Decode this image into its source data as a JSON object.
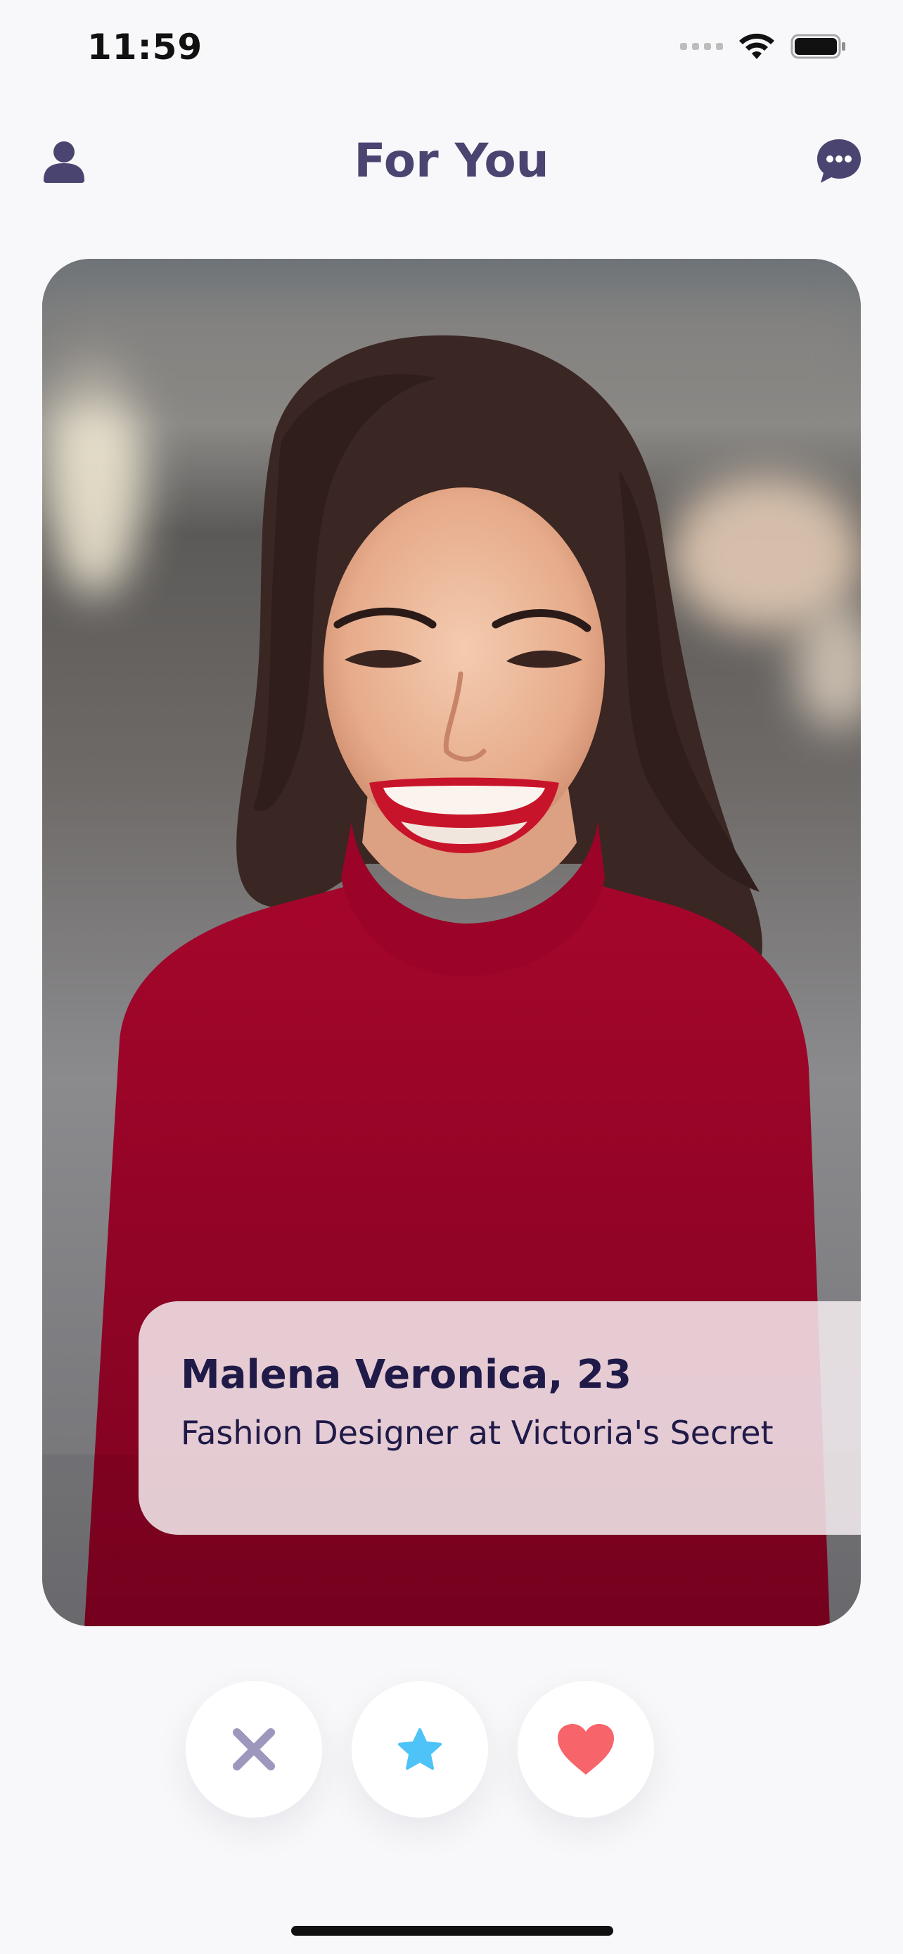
{
  "status_bar": {
    "time": "11:59"
  },
  "header": {
    "title": "For You",
    "left_icon": "person-icon",
    "right_icon": "chat-bubble-icon"
  },
  "profile_card": {
    "name_age": "Malena Veronica, 23",
    "job": "Fashion Designer at Victoria's Secret"
  },
  "actions": {
    "nope_icon": "x-icon",
    "super_like_icon": "star-icon",
    "like_icon": "heart-icon"
  },
  "colors": {
    "title": "#4a4470",
    "name_text": "#1f1a48",
    "nope": "#9e97bd",
    "super_like": "#4dc3f7",
    "like": "#f7646a"
  }
}
